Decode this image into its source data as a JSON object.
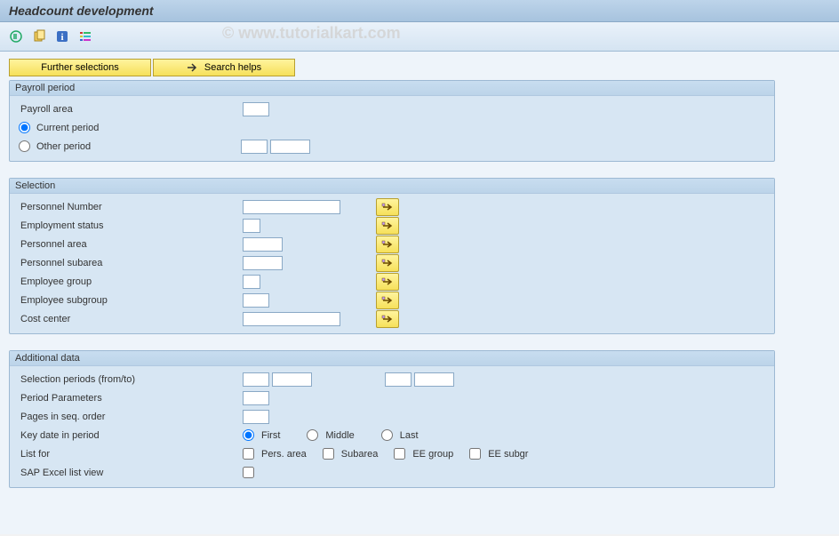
{
  "title": "Headcount development",
  "watermark": "© www.tutorialkart.com",
  "buttons": {
    "further": "Further selections",
    "search": "Search helps"
  },
  "groups": {
    "payroll": {
      "title": "Payroll period",
      "area_label": "Payroll area",
      "current_label": "Current period",
      "other_label": "Other period"
    },
    "selection": {
      "title": "Selection",
      "rows": [
        "Personnel Number",
        "Employment status",
        "Personnel area",
        "Personnel subarea",
        "Employee group",
        "Employee subgroup",
        "Cost center"
      ]
    },
    "additional": {
      "title": "Additional data",
      "sel_periods": "Selection periods (from/to)",
      "period_params": "Period Parameters",
      "pages_seq": "Pages in seq. order",
      "key_date": "Key date in period",
      "key_opts": {
        "first": "First",
        "middle": "Middle",
        "last": "Last"
      },
      "list_for": "List for",
      "list_opts": {
        "pa": "Pers. area",
        "sa": "Subarea",
        "eg": "EE group",
        "esg": "EE subgr"
      },
      "excel": "SAP Excel list view"
    }
  }
}
